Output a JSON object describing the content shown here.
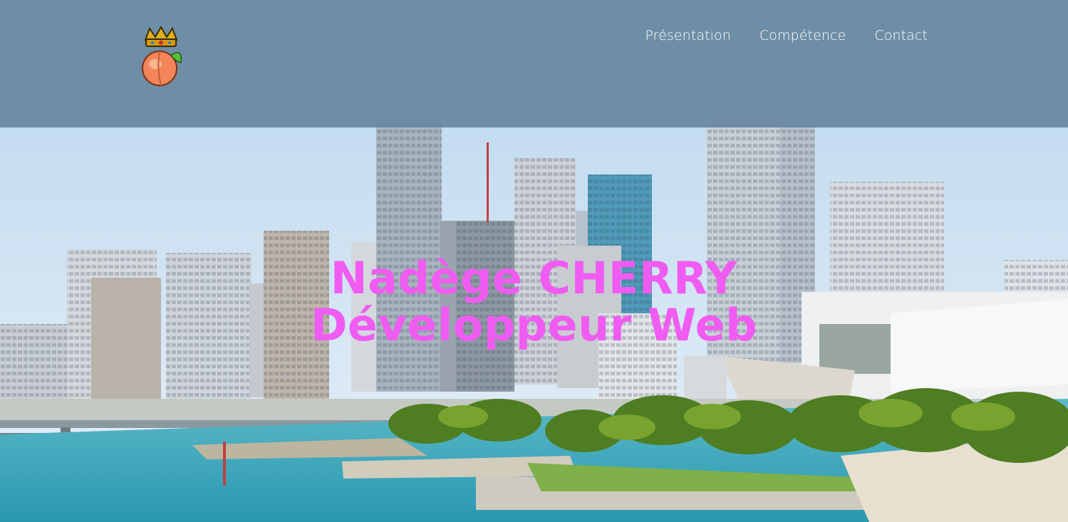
{
  "page": {
    "accent_color": "#f05cf2",
    "header_color": "#6888a0"
  },
  "header": {
    "logo_icon": "crowned-peach-icon",
    "nav": [
      {
        "label": "Présentation"
      },
      {
        "label": "Compétence"
      },
      {
        "label": "Contact"
      }
    ]
  },
  "hero": {
    "name": "Nadège CHERRY",
    "role": "Développeur Web",
    "background": "city-skyline-waterfront-image"
  }
}
